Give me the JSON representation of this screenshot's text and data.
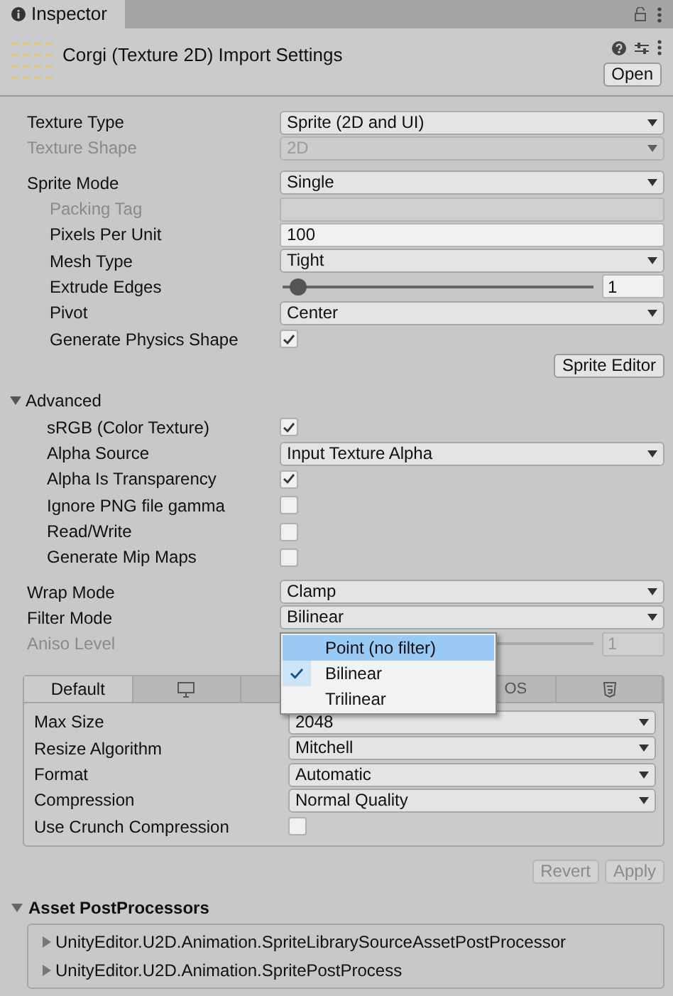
{
  "window": {
    "tab": "Inspector"
  },
  "header": {
    "title": "Corgi (Texture 2D) Import Settings",
    "open_button": "Open"
  },
  "sections": [
    [
      {
        "kind": "dropdown",
        "label": "Texture Type",
        "value": "Sprite (2D and UI)",
        "disabled": false
      },
      {
        "kind": "dropdown",
        "label": "Texture Shape",
        "value": "2D",
        "disabled": true
      }
    ],
    [
      {
        "kind": "dropdown",
        "label": "Sprite Mode",
        "value": "Single",
        "disabled": false,
        "children": [
          {
            "kind": "field",
            "label": "Packing Tag",
            "disabled": true
          },
          {
            "kind": "field",
            "label": "Pixels Per Unit",
            "value": "100",
            "disabled": false
          },
          {
            "kind": "dropdown",
            "label": "Mesh Type",
            "value": "Tight",
            "disabled": false
          },
          {
            "kind": "slider",
            "label": "Extrude Edges",
            "value": "1",
            "level": 0.05,
            "disabled": false
          },
          {
            "kind": "dropdown",
            "label": "Pivot",
            "value": "Center",
            "disabled": false
          },
          {
            "kind": "checkbox",
            "label": "Generate Physics Shape",
            "checked": true
          }
        ]
      },
      {
        "kind": "button",
        "label": "Sprite Editor"
      },
      {
        "kind": "foldout",
        "label": "Advanced",
        "expanded": true,
        "children": [
          {
            "kind": "checkbox",
            "label": "sRGB (Color Texture)",
            "checked": true
          },
          {
            "kind": "dropdown",
            "label": "Alpha Source",
            "value": "Input Texture Alpha",
            "disabled": false
          },
          {
            "kind": "checkbox",
            "label": "Alpha Is Transparency",
            "checked": true
          },
          {
            "kind": "checkbox",
            "label": "Ignore PNG file gamma",
            "checked": false
          },
          {
            "kind": "checkbox",
            "label": "Read/Write",
            "checked": false
          },
          {
            "kind": "checkbox",
            "label": "Generate Mip Maps",
            "checked": false
          }
        ]
      }
    ],
    [
      {
        "kind": "dropdown",
        "label": "Wrap Mode",
        "value": "Clamp",
        "disabled": false
      },
      {
        "kind": "dropdown",
        "label": "Filter Mode",
        "value": "Bilinear",
        "disabled": false
      },
      {
        "kind": "slider",
        "label": "Aniso Level",
        "value": "1",
        "disabled": true
      }
    ]
  ],
  "dropdown_menu": {
    "items": [
      {
        "label": "Point (no filter)",
        "highlighted": true,
        "checked": false
      },
      {
        "label": "Bilinear",
        "highlighted": false,
        "checked": true
      },
      {
        "label": "Trilinear",
        "highlighted": false,
        "checked": false
      }
    ]
  },
  "platform_tabs": [
    {
      "kind": "text",
      "label": "Default",
      "selected": true
    },
    {
      "kind": "desktop",
      "selected": false
    },
    {
      "kind": "blank",
      "selected": false
    },
    {
      "kind": "text",
      "label": "OS",
      "selected": false
    },
    {
      "kind": "html5",
      "selected": false
    }
  ],
  "platform_rows": [
    {
      "kind": "dropdown",
      "label": "Max Size",
      "value": "2048",
      "disabled": false
    },
    {
      "kind": "dropdown",
      "label": "Resize Algorithm",
      "value": "Mitchell",
      "disabled": false
    },
    {
      "kind": "dropdown",
      "label": "Format",
      "value": "Automatic",
      "disabled": false
    },
    {
      "kind": "dropdown",
      "label": "Compression",
      "value": "Normal Quality",
      "disabled": false
    },
    {
      "kind": "checkbox",
      "label": "Use Crunch Compression",
      "checked": false
    }
  ],
  "footer_buttons": [
    {
      "label": "Revert",
      "disabled": true
    },
    {
      "label": "Apply",
      "disabled": true
    }
  ],
  "postprocessors": {
    "title": "Asset PostProcessors",
    "expanded": true,
    "items": [
      {
        "label": "UnityEditor.U2D.Animation.SpriteLibrarySourceAssetPostProcessor",
        "expanded": false
      },
      {
        "label": "UnityEditor.U2D.Animation.SpritePostProcess",
        "expanded": false
      }
    ]
  }
}
